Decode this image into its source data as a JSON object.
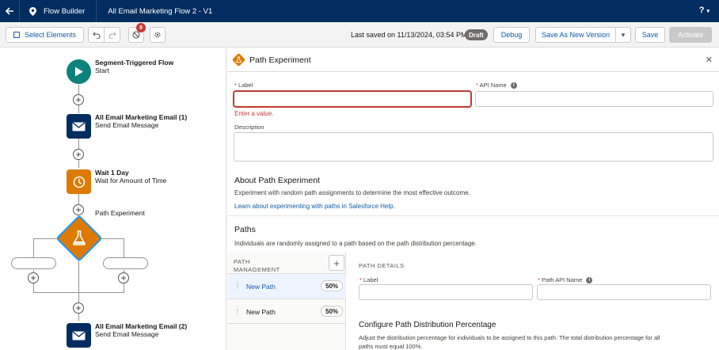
{
  "topbar": {
    "app_name": "Flow Builder",
    "flow_title": "All Email Marketing Flow 2 - V1",
    "help_label": "?"
  },
  "toolbar": {
    "select_elements": "Select Elements",
    "error_count": "9",
    "last_saved": "Last saved on 11/13/2024, 03:54 PM",
    "status_badge": "Draft",
    "debug": "Debug",
    "save_as_new_version": "Save As New Version",
    "save": "Save",
    "activate": "Activate"
  },
  "canvas": {
    "nodes": [
      {
        "title": "Segment-Triggered Flow",
        "subtitle": "Start",
        "icon": "play-icon",
        "color": "#0b827c"
      },
      {
        "title": "All Email Marketing Email (1)",
        "subtitle": "Send Email Message",
        "icon": "mail-icon",
        "color": "#032d60"
      },
      {
        "title": "Wait 1 Day",
        "subtitle": "Wait for Amount of Time",
        "icon": "clock-icon",
        "color": "#dd7a01"
      },
      {
        "title": "Path Experiment",
        "subtitle": "",
        "icon": "flask-icon",
        "color": "#dd7a01"
      },
      {
        "title": "All Email Marketing Email (2)",
        "subtitle": "Send Email Message",
        "icon": "mail-icon",
        "color": "#032d60"
      }
    ]
  },
  "panel": {
    "title": "Path Experiment",
    "label_field": {
      "label": "Label",
      "value": "",
      "error": "Enter a value."
    },
    "api_name_field": {
      "label": "API Name",
      "value": ""
    },
    "description_field": {
      "label": "Description",
      "value": ""
    },
    "about": {
      "heading": "About Path Experiment",
      "text": "Experiment with random path assignments to determine the most effective outcome.",
      "link": "Learn about experimenting with paths in Salesforce Help."
    },
    "paths": {
      "heading": "Paths",
      "text": "Individuals are randomly assigned to a path based on the path distribution percentage.",
      "management_heading_line1": "PATH",
      "management_heading_line2": "MANAGEMENT",
      "items": [
        {
          "name": "New Path",
          "percent": "50%"
        },
        {
          "name": "New Path",
          "percent": "50%"
        }
      ],
      "details_heading": "PATH DETAILS",
      "detail_label": "Label",
      "detail_api_name": "Path API Name",
      "distribution_heading": "Configure Path Distribution Percentage",
      "distribution_text_1": "Adjust the distribution percentage for individuals to be assigned to this path. The total distribution percentage for all",
      "distribution_text_2": "paths must equal 100%."
    }
  }
}
